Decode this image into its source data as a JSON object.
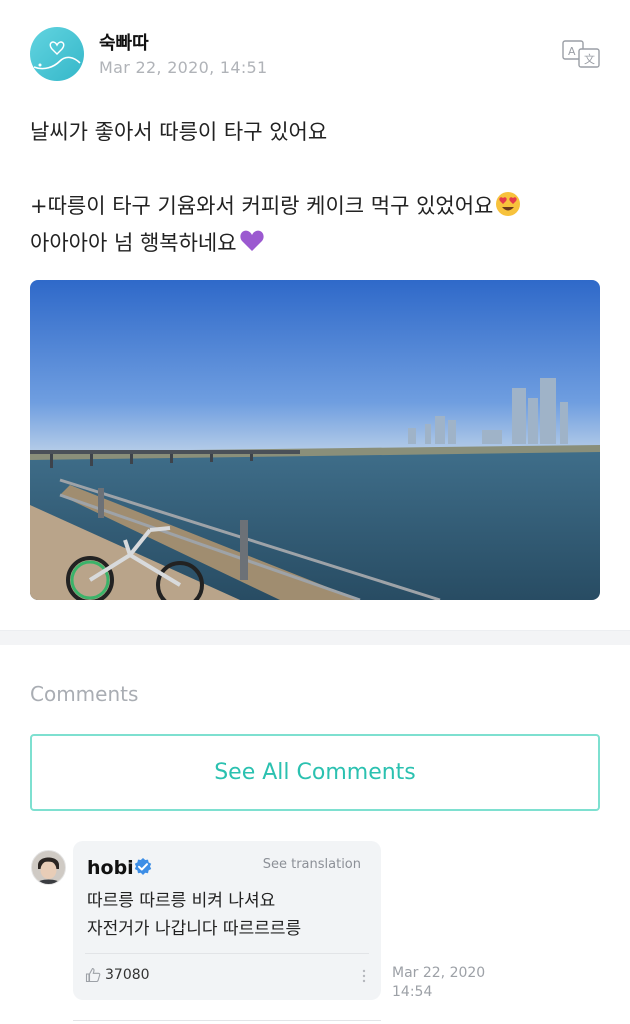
{
  "post": {
    "author": "숙빠따",
    "date": "Mar 22, 2020, 14:51",
    "lines": [
      "날씨가 좋아서 따릉이 타구 있어요",
      "",
      "+따릉이 타구 기윰와서 커피랑 케이크 먹구 있었어요",
      "아아아아 넘 행복하네요"
    ],
    "emojis": [
      "smiling-face-with-heart-eyes",
      "purple-heart"
    ]
  },
  "comments": {
    "heading": "Comments",
    "see_all_label": "See All Comments",
    "items": [
      {
        "author": "hobi",
        "verified": true,
        "see_translation": "See translation",
        "lines": [
          "따르릉 따르릉 비켜 나셔요",
          "자전거가 나갑니다 따르르르릉"
        ],
        "likes": "37080",
        "date_line1": "Mar 22, 2020",
        "date_line2": "14:54"
      }
    ]
  },
  "colors": {
    "accent": "#2bc1b0",
    "accent_border": "#7ee0d0",
    "muted": "#a9adb3",
    "bubble": "#f2f4f6"
  }
}
